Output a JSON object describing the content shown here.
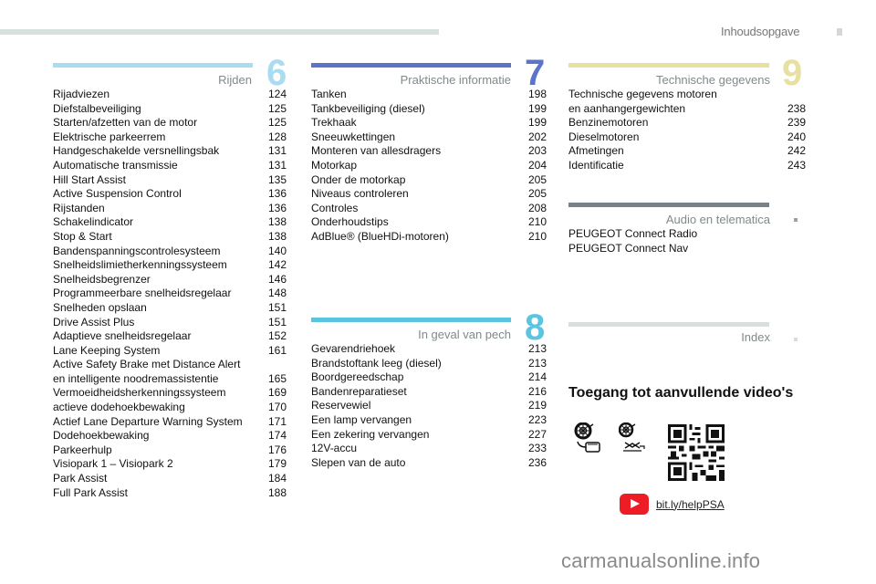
{
  "header": {
    "title": "Inhoudsopgave"
  },
  "sections": [
    {
      "number": "6",
      "title": "Rijden",
      "color": "#a9dcf0",
      "entries": [
        {
          "label": "Rijadviezen",
          "page": "124"
        },
        {
          "label": "Diefstalbeveiliging",
          "page": "125"
        },
        {
          "label": "Starten/afzetten van de motor",
          "page": "125"
        },
        {
          "label": "Elektrische parkeerrem",
          "page": "128"
        },
        {
          "label": "Handgeschakelde versnellingsbak",
          "page": "131"
        },
        {
          "label": "Automatische transmissie",
          "page": "131"
        },
        {
          "label": "Hill Start Assist",
          "page": "135"
        },
        {
          "label": "Active Suspension Control",
          "page": "136"
        },
        {
          "label": "Rijstanden",
          "page": "136"
        },
        {
          "label": "Schakelindicator",
          "page": "138"
        },
        {
          "label": "Stop & Start",
          "page": "138"
        },
        {
          "label": "Bandenspanningscontrolesysteem",
          "page": "140"
        },
        {
          "label": "Snelheidslimietherkenningssysteem",
          "page": "142"
        },
        {
          "label": "Snelheidsbegrenzer",
          "page": "146"
        },
        {
          "label": "Programmeerbare snelheidsregelaar",
          "page": "148"
        },
        {
          "label": "Snelheden opslaan",
          "page": "151"
        },
        {
          "label": "Drive Assist Plus",
          "page": "151"
        },
        {
          "label": "Adaptieve snelheidsregelaar",
          "page": "152"
        },
        {
          "label": "Lane Keeping System",
          "page": "161"
        },
        {
          "label": "Active Safety Brake met Distance Alert\nen intelligente noodremassistentie",
          "page": "165"
        },
        {
          "label": "Vermoeidheidsherkenningssysteem",
          "page": "169"
        },
        {
          "label": "actieve dodehoekbewaking",
          "page": "170"
        },
        {
          "label": "Actief Lane Departure Warning System",
          "page": "171"
        },
        {
          "label": "Dodehoekbewaking",
          "page": "174"
        },
        {
          "label": "Parkeerhulp",
          "page": "176"
        },
        {
          "label": "Visiopark 1 – Visiopark 2",
          "page": "179"
        },
        {
          "label": "Park Assist",
          "page": "184"
        },
        {
          "label": "Full Park Assist",
          "page": "188"
        }
      ]
    },
    {
      "number": "7",
      "title": "Praktische informatie",
      "color": "#5b73c9",
      "entries": [
        {
          "label": "Tanken",
          "page": "198"
        },
        {
          "label": "Tankbeveiliging (diesel)",
          "page": "199"
        },
        {
          "label": "Trekhaak",
          "page": "199"
        },
        {
          "label": "Sneeuwkettingen",
          "page": "202"
        },
        {
          "label": "Monteren van allesdragers",
          "page": "203"
        },
        {
          "label": "Motorkap",
          "page": "204"
        },
        {
          "label": "Onder de motorkap",
          "page": "205"
        },
        {
          "label": "Niveaus controleren",
          "page": "205"
        },
        {
          "label": "Controles",
          "page": "208"
        },
        {
          "label": "Onderhoudstips",
          "page": "210"
        },
        {
          "label": "AdBlue® (BlueHDi-motoren)",
          "page": "210"
        }
      ]
    },
    {
      "number": "8",
      "title": "In geval van pech",
      "color": "#5bc4e0",
      "entries": [
        {
          "label": "Gevarendriehoek",
          "page": "213"
        },
        {
          "label": "Brandstoftank leeg (diesel)",
          "page": "213"
        },
        {
          "label": "Boordgereedschap",
          "page": "214"
        },
        {
          "label": "Bandenreparatieset",
          "page": "216"
        },
        {
          "label": "Reservewiel",
          "page": "219"
        },
        {
          "label": "Een lamp vervangen",
          "page": "223"
        },
        {
          "label": "Een zekering vervangen",
          "page": "227"
        },
        {
          "label": "12V-accu",
          "page": "233"
        },
        {
          "label": "Slepen van de auto",
          "page": "236"
        }
      ]
    },
    {
      "number": "9",
      "title": "Technische gegevens",
      "color": "#e8e0a0",
      "entries": [
        {
          "label": "Technische gegevens motoren\nen aanhangergewichten",
          "page": "238"
        },
        {
          "label": "Benzinemotoren",
          "page": "239"
        },
        {
          "label": "Dieselmotoren",
          "page": "240"
        },
        {
          "label": "Afmetingen",
          "page": "242"
        },
        {
          "label": "Identificatie",
          "page": "243"
        }
      ]
    },
    {
      "number": "",
      "title": "Audio en telematica",
      "color": "#7a8288",
      "entries": [
        {
          "label": "PEUGEOT Connect Radio",
          "page": ""
        },
        {
          "label": "PEUGEOT Connect Nav",
          "page": ""
        }
      ]
    },
    {
      "number": "",
      "title": "Index",
      "color": "#d8e0dc",
      "entries": []
    }
  ],
  "videos": {
    "title": "Toegang tot aanvullende video's",
    "link": "bit.ly/helpPSA"
  },
  "watermark": "carmanualsonline.info"
}
